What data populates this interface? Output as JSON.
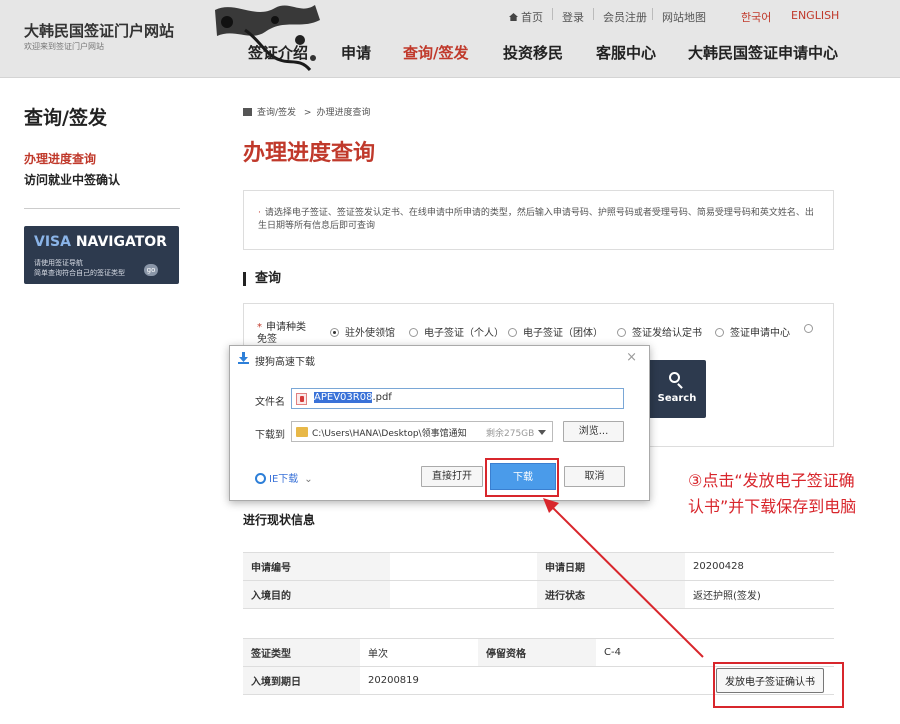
{
  "header": {
    "site_title": "大韩民国签证门户网站",
    "site_subtitle": "欢迎来到签证门户网站",
    "util_links": [
      "首页",
      "登录",
      "会员注册",
      "网站地图"
    ],
    "lang_links": [
      "한국어",
      "ENGLISH"
    ],
    "nav": [
      "签证介绍",
      "申请",
      "查询/签发",
      "投资移民",
      "客服中心",
      "大韩民国签证申请中心"
    ],
    "active_nav": "查询/签发"
  },
  "sidebar": {
    "title": "查询/签发",
    "items": [
      "办理进度查询",
      "访问就业中签确认"
    ],
    "active_item": "办理进度查询",
    "banner": {
      "title_part1": "VISA",
      "title_part2": "NAVIGATOR",
      "desc_line1": "请使用签证导航",
      "desc_line2": "简单查询符合自己的签证类型",
      "go": "go"
    }
  },
  "breadcrumb": [
    "查询/签发",
    "办理进度查询"
  ],
  "page_title": "办理进度查询",
  "notice": "请选择电子签证、签证签发认定书、在线申请中所申请的类型，然后输入申请号码、护照号码或者受理号码、简易受理号码和英文姓名、出生日期等所有信息后即可查询",
  "search_section": {
    "title": "查询",
    "field_label": "申请种类",
    "field_label_overflow": "免签",
    "options": [
      "驻外使领馆",
      "电子签证（个人）",
      "电子签证（团体）",
      "签证发给认定书",
      "签证申请中心"
    ],
    "selected": "驻外使领馆",
    "search_button": "Search"
  },
  "progress": {
    "title": "进行现状信息",
    "table1": [
      {
        "label": "申请编号",
        "value": "",
        "label2": "申请日期",
        "value2": "20200428"
      },
      {
        "label": "入境目的",
        "value": "",
        "label2": "进行状态",
        "value2": "返还护照(签发)"
      }
    ],
    "table2": [
      {
        "label": "签证类型",
        "value": "单次",
        "label2": "停留资格",
        "value2": "C-4"
      },
      {
        "label": "入境到期日",
        "value": "20200819"
      }
    ],
    "issue_button": "发放电子签证确认书"
  },
  "dialog": {
    "title": "搜狗高速下载",
    "filename_label": "文件名",
    "filename_selected": "APEV03R08",
    "filename_ext": ".pdf",
    "path_label": "下载到",
    "path": "C:\\Users\\HANA\\Desktop\\领事馆通知",
    "free_space": "剩余275GB",
    "browse": "浏览...",
    "ie_download": "IE下载",
    "open_direct": "直接打开",
    "download": "下载",
    "cancel": "取消"
  },
  "annotation": "③点击“发放电子签证确认书”并下载保存到电脑",
  "colors": {
    "accent_red": "#c0392b",
    "annotation_red": "#d8262c",
    "navy": "#2d3a4e",
    "download_blue": "#4a9bea"
  }
}
